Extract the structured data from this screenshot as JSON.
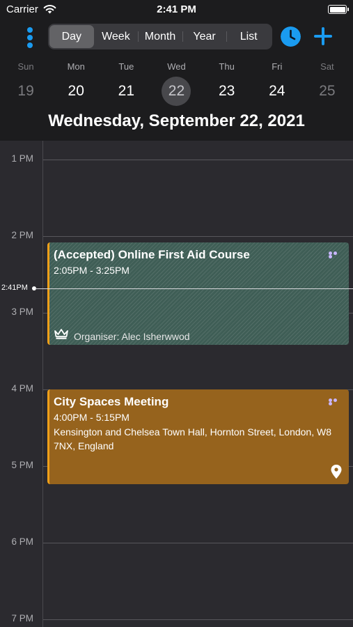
{
  "status_bar": {
    "carrier": "Carrier",
    "time": "2:41 PM",
    "battery_level": 1.0
  },
  "toolbar": {
    "tabs": [
      {
        "label": "Day",
        "active": true
      },
      {
        "label": "Week",
        "active": false
      },
      {
        "label": "Month",
        "active": false
      },
      {
        "label": "Year",
        "active": false
      },
      {
        "label": "List",
        "active": false
      }
    ],
    "accent_color": "#1a9bf0",
    "icons": [
      "more-vertical-icon",
      "clock-icon",
      "plus-icon"
    ]
  },
  "week": {
    "days": [
      {
        "name": "Sun",
        "date": "19",
        "dim": true
      },
      {
        "name": "Mon",
        "date": "20",
        "dim": false
      },
      {
        "name": "Tue",
        "date": "21",
        "dim": false
      },
      {
        "name": "Wed",
        "date": "22",
        "dim": false,
        "selected": true
      },
      {
        "name": "Thu",
        "date": "23",
        "dim": false
      },
      {
        "name": "Fri",
        "date": "24",
        "dim": false
      },
      {
        "name": "Sat",
        "date": "25",
        "dim": true
      }
    ],
    "full_date": "Wednesday, September 22, 2021"
  },
  "timeline": {
    "hours": [
      "1 PM",
      "2 PM",
      "3 PM",
      "4 PM",
      "5 PM",
      "6 PM",
      "7 PM"
    ],
    "now_label": "2:41PM"
  },
  "events": [
    {
      "title": "(Accepted) Online First Aid Course",
      "time": "2:05PM - 3:25PM",
      "organiser": "Organiser: Alec Isherwwod",
      "color": "#3f5e56",
      "icon": "crown-icon"
    },
    {
      "title": "City Spaces Meeting",
      "time": "4:00PM - 5:15PM",
      "location": "Kensington and Chelsea Town Hall, Hornton Street, London, W8 7NX, England",
      "color": "#96631d",
      "icon": "location-pin-icon"
    }
  ]
}
